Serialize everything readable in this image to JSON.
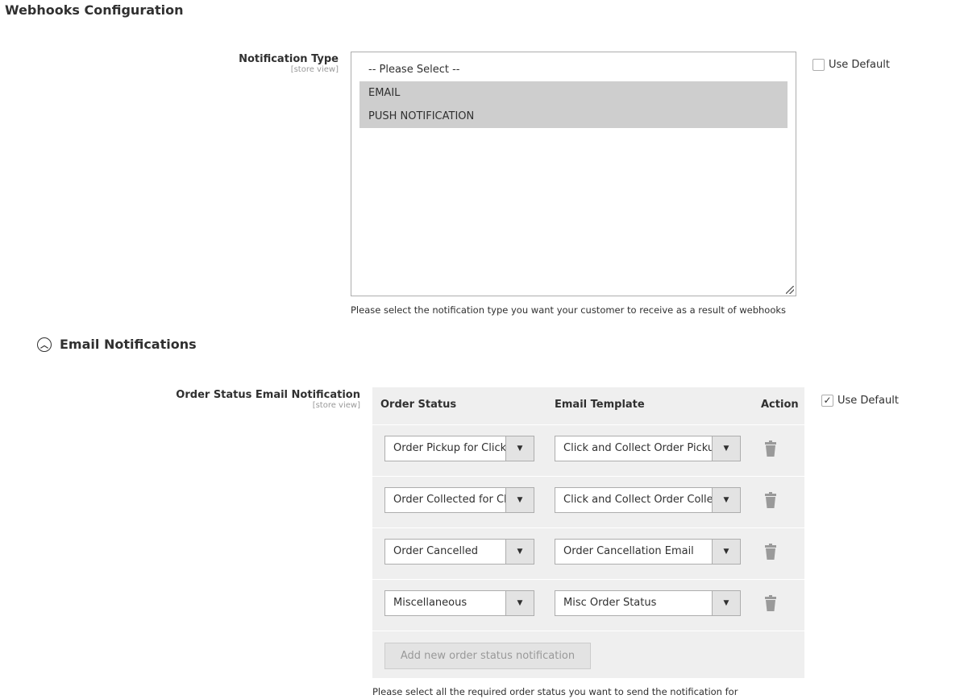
{
  "title": "Webhooks Configuration",
  "notification_type": {
    "label": "Notification Type",
    "scope": "[store view]",
    "options": [
      "-- Please Select --",
      "EMAIL",
      "PUSH NOTIFICATION"
    ],
    "selected": [
      "EMAIL",
      "PUSH NOTIFICATION"
    ],
    "use_default": "Use Default",
    "use_default_checked": false,
    "hint": "Please select the notification type you want your customer to receive as a result of webhooks"
  },
  "email_section": {
    "title": "Email Notifications"
  },
  "order_status": {
    "label": "Order Status Email Notification",
    "scope": "[store view]",
    "use_default": "Use Default",
    "use_default_checked": true,
    "headers": {
      "status": "Order Status",
      "template": "Email Template",
      "action": "Action"
    },
    "rows": [
      {
        "status": "Order Pickup for Click and Collect",
        "template": "Click and Collect Order Pickup"
      },
      {
        "status": "Order Collected for Click and Collect",
        "template": "Click and Collect Order Collected"
      },
      {
        "status": "Order Cancelled",
        "template": "Order Cancellation Email"
      },
      {
        "status": "Miscellaneous",
        "template": "Misc Order Status"
      }
    ],
    "add_button": "Add new order status notification",
    "hint": "Please select all the required order status you want to send the notification for"
  }
}
